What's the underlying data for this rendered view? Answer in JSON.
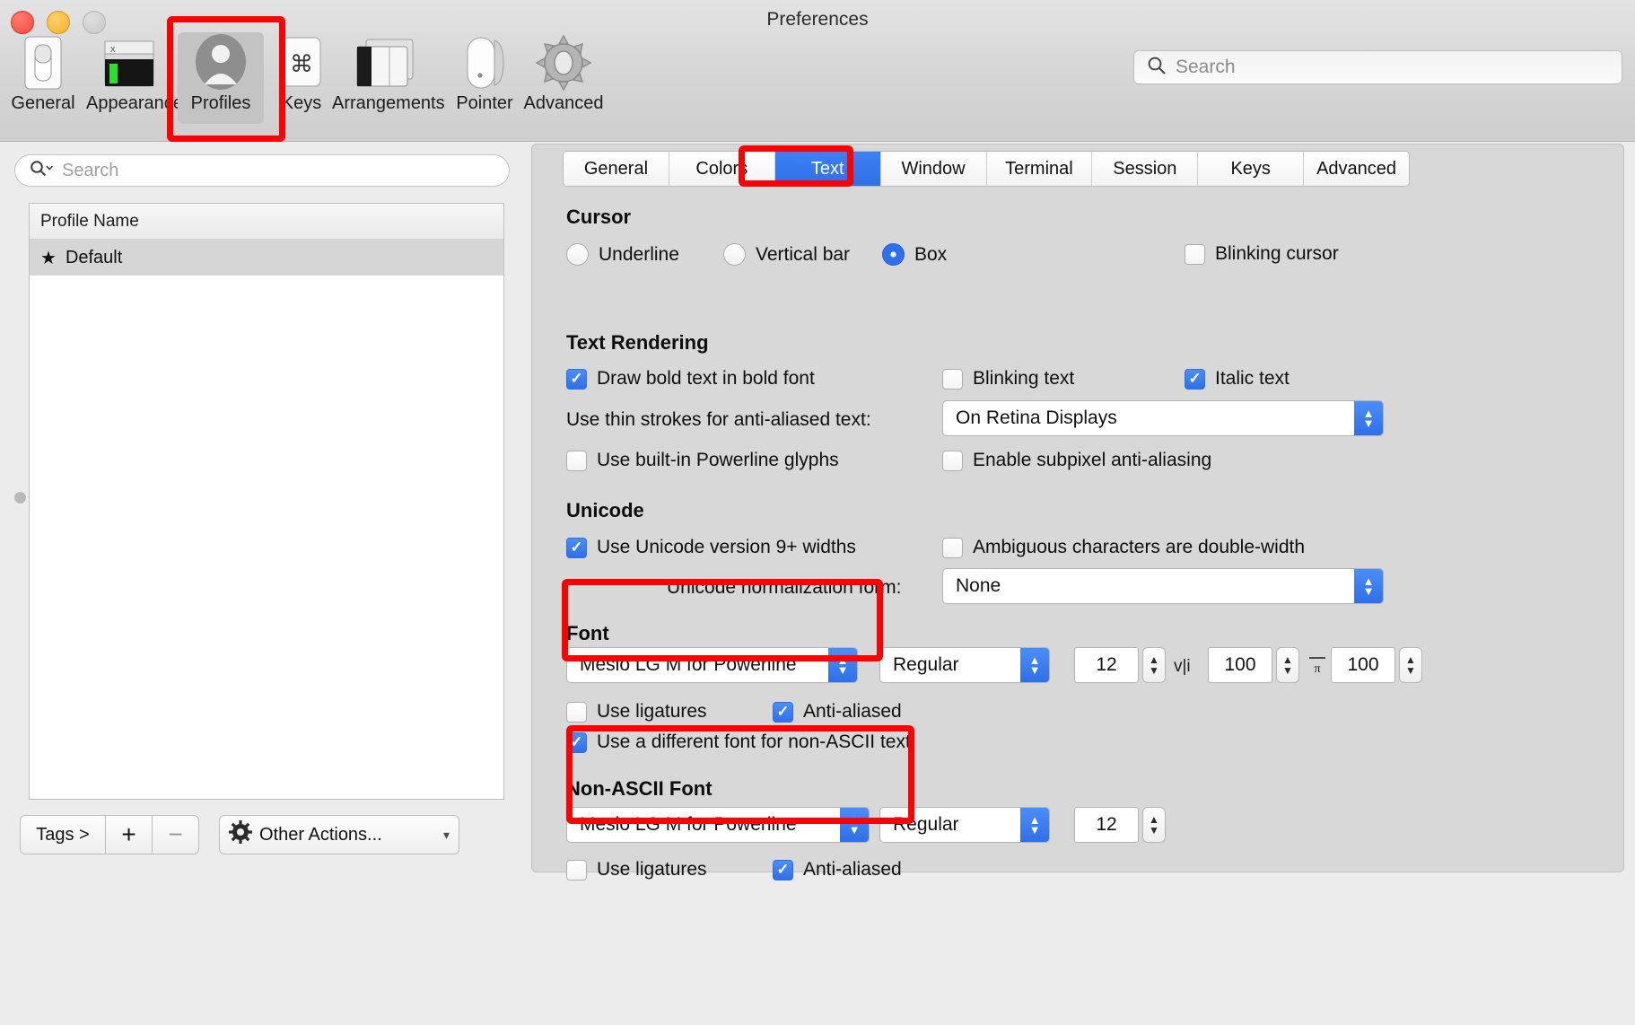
{
  "window": {
    "title": "Preferences",
    "traffic_lights": [
      "close",
      "minimize",
      "maximize"
    ]
  },
  "toolbar": {
    "search_placeholder": "Search",
    "items": [
      {
        "label": "General",
        "icon": "general-switch-icon",
        "selected": false
      },
      {
        "label": "Appearance",
        "icon": "appearance-window-icon",
        "selected": false
      },
      {
        "label": "Profiles",
        "icon": "profiles-person-icon",
        "selected": true
      },
      {
        "label": "Keys",
        "icon": "keys-command-icon",
        "selected": false
      },
      {
        "label": "Arrangements",
        "icon": "arrangements-panes-icon",
        "selected": false
      },
      {
        "label": "Pointer",
        "icon": "pointer-mouse-icon",
        "selected": false
      },
      {
        "label": "Advanced",
        "icon": "advanced-gear-icon",
        "selected": false
      }
    ]
  },
  "sidebar": {
    "search_placeholder": "Search",
    "column_header": "Profile Name",
    "rows": [
      {
        "name": "Default",
        "starred": true,
        "selected": true
      }
    ],
    "bottom_bar": {
      "tags_label": "Tags >",
      "add_label": "+",
      "remove_label": "−",
      "other_actions_label": "Other Actions...",
      "other_actions_chevron": "⌄"
    }
  },
  "tabs": [
    {
      "label": "General",
      "active": false
    },
    {
      "label": "Colors",
      "active": false
    },
    {
      "label": "Text",
      "active": true
    },
    {
      "label": "Window",
      "active": false
    },
    {
      "label": "Terminal",
      "active": false
    },
    {
      "label": "Session",
      "active": false
    },
    {
      "label": "Keys",
      "active": false
    },
    {
      "label": "Advanced",
      "active": false
    }
  ],
  "sections": {
    "cursor": {
      "title": "Cursor",
      "radios": [
        {
          "label": "Underline",
          "checked": false
        },
        {
          "label": "Vertical bar",
          "checked": false
        },
        {
          "label": "Box",
          "checked": true
        }
      ],
      "blinking_cursor": {
        "label": "Blinking cursor",
        "checked": false
      }
    },
    "text_rendering": {
      "title": "Text Rendering",
      "draw_bold": {
        "label": "Draw bold text in bold font",
        "checked": true
      },
      "blinking_text": {
        "label": "Blinking text",
        "checked": false
      },
      "italic_text": {
        "label": "Italic text",
        "checked": true
      },
      "thin_strokes_label": "Use thin strokes for anti-aliased text:",
      "thin_strokes_value": "On Retina Displays",
      "powerline": {
        "label": "Use built-in Powerline glyphs",
        "checked": false
      },
      "subpixel": {
        "label": "Enable subpixel anti-aliasing",
        "checked": false
      }
    },
    "unicode": {
      "title": "Unicode",
      "unicode9": {
        "label": "Use Unicode version 9+ widths",
        "checked": true
      },
      "ambiguous": {
        "label": "Ambiguous characters are double-width",
        "checked": false
      },
      "normalization_label": "Unicode normalization form:",
      "normalization_value": "None"
    },
    "font": {
      "title": "Font",
      "family": "Meslo LG M for Powerline",
      "style": "Regular",
      "size": "12",
      "horizontal_glyph": "v|i",
      "horizontal_spacing": "100",
      "vertical_glyph": "ᴨ",
      "vertical_spacing": "100",
      "ligatures": {
        "label": "Use ligatures",
        "checked": false
      },
      "antialiased": {
        "label": "Anti-aliased",
        "checked": true
      },
      "different_non_ascii": {
        "label": "Use a different font for non-ASCII text",
        "checked": true
      }
    },
    "non_ascii_font": {
      "title": "Non-ASCII Font",
      "family": "Meslo LG M for Powerline",
      "style": "Regular",
      "size": "12",
      "ligatures": {
        "label": "Use ligatures",
        "checked": false
      },
      "antialiased": {
        "label": "Anti-aliased",
        "checked": true
      }
    }
  },
  "annotations": {
    "color": "#ff0000",
    "boxes": [
      "profiles-toolbar-item",
      "text-tab",
      "font-popup",
      "non-ascii-font-popup"
    ]
  }
}
